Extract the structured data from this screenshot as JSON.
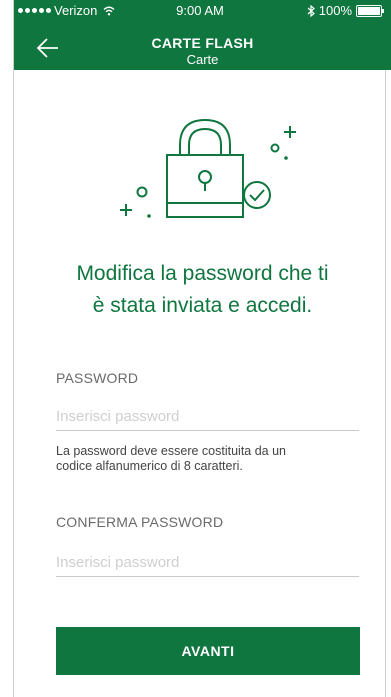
{
  "status_bar": {
    "carrier": "Verizon",
    "time": "9:00 AM",
    "battery": "100%",
    "battery_level": 1.0
  },
  "header": {
    "title": "CARTE FLASH",
    "subtitle": "Carte",
    "back_icon": "arrow-left-icon",
    "background": "#10763f"
  },
  "illustration": {
    "icon": "padlock-with-check-icon",
    "color": "#10763f"
  },
  "main": {
    "headline_line1": "Modifica la password che ti",
    "headline_line2": "è stata inviata e accedi.",
    "password_label": "PASSWORD",
    "password_placeholder": "Inserisci password",
    "password_hint_line1": "La password deve essere costituita da un",
    "password_hint_line2": "codice alfanumerico di 8 caratteri.",
    "confirm_label": "CONFERMA PASSWORD",
    "confirm_placeholder": "Inserisci password",
    "submit_label": "AVANTI"
  },
  "colors": {
    "accent": "#10763f"
  }
}
